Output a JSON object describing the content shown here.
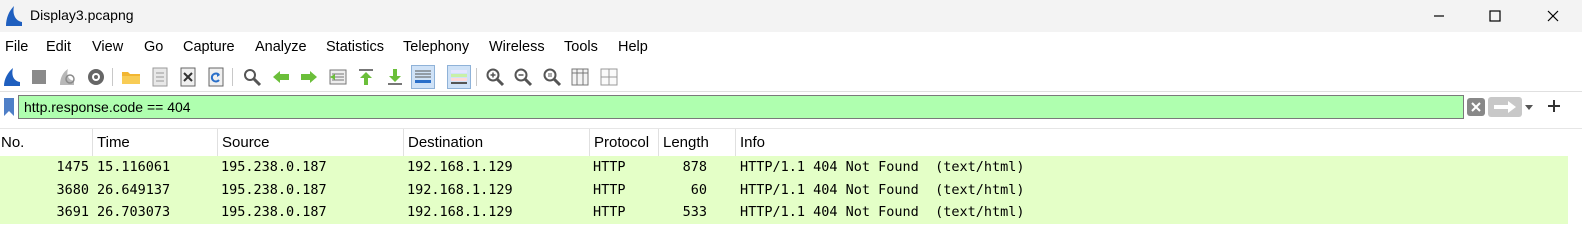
{
  "window": {
    "title": "Display3.pcapng"
  },
  "menu": [
    "File",
    "Edit",
    "View",
    "Go",
    "Capture",
    "Analyze",
    "Statistics",
    "Telephony",
    "Wireless",
    "Tools",
    "Help"
  ],
  "toolbar": {
    "icons": [
      "start-capture-icon",
      "stop-capture-icon",
      "restart-capture-icon",
      "capture-options-icon",
      "open-file-icon",
      "save-file-icon",
      "close-file-icon",
      "reload-file-icon",
      "find-packet-icon",
      "go-back-icon",
      "go-forward-icon",
      "go-to-packet-icon",
      "go-first-icon",
      "go-last-icon",
      "autoscroll-icon",
      "colorize-icon",
      "zoom-in-icon",
      "zoom-out-icon",
      "zoom-normal-icon",
      "resize-columns-icon",
      "layout-icon"
    ]
  },
  "filter": {
    "value": "http.response.code == 404"
  },
  "packet_list": {
    "columns": [
      "No.",
      "Time",
      "Source",
      "Destination",
      "Protocol",
      "Length",
      "Info"
    ],
    "rows": [
      {
        "no": "1475",
        "time": "15.116061",
        "source": "195.238.0.187",
        "destination": "192.168.1.129",
        "protocol": "HTTP",
        "length": "878",
        "info": "HTTP/1.1 404 Not Found  (text/html)"
      },
      {
        "no": "3680",
        "time": "26.649137",
        "source": "195.238.0.187",
        "destination": "192.168.1.129",
        "protocol": "HTTP",
        "length": "60",
        "info": "HTTP/1.1 404 Not Found  (text/html)"
      },
      {
        "no": "3691",
        "time": "26.703073",
        "source": "195.238.0.187",
        "destination": "192.168.1.129",
        "protocol": "HTTP",
        "length": "533",
        "info": "HTTP/1.1 404 Not Found  (text/html)"
      }
    ],
    "row_color": "#e4ffc7"
  },
  "colors": {
    "filter_valid": "#afffaf",
    "accent": "#1f5fbf"
  }
}
